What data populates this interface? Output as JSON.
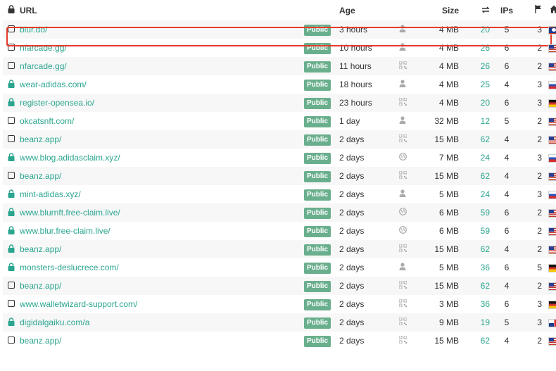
{
  "headers": {
    "url": "URL",
    "age": "Age",
    "size": "Size",
    "ips": "IPs"
  },
  "badge_label": "Public",
  "rows": [
    {
      "url": "blur.do/",
      "age": "3 hours",
      "type": "user",
      "size": "4 MB",
      "links": "20",
      "ips": "5",
      "ctry": "3",
      "flag": "bz",
      "locked": false
    },
    {
      "url": "nfarcade.gg/",
      "age": "10 hours",
      "type": "user",
      "size": "4 MB",
      "links": "26",
      "ips": "6",
      "ctry": "2",
      "flag": "us",
      "locked": false
    },
    {
      "url": "nfarcade.gg/",
      "age": "11 hours",
      "type": "qr",
      "size": "4 MB",
      "links": "26",
      "ips": "6",
      "ctry": "2",
      "flag": "us",
      "locked": false
    },
    {
      "url": "wear-adidas.com/",
      "age": "18 hours",
      "type": "user",
      "size": "4 MB",
      "links": "25",
      "ips": "4",
      "ctry": "3",
      "flag": "ru",
      "locked": true
    },
    {
      "url": "register-opensea.io/",
      "age": "23 hours",
      "type": "qr",
      "size": "4 MB",
      "links": "20",
      "ips": "6",
      "ctry": "3",
      "flag": "de",
      "locked": true
    },
    {
      "url": "okcatsnft.com/",
      "age": "1 day",
      "type": "user",
      "size": "32 MB",
      "links": "12",
      "ips": "5",
      "ctry": "2",
      "flag": "us",
      "locked": false
    },
    {
      "url": "beanz.app/",
      "age": "2 days",
      "type": "qr",
      "size": "15 MB",
      "links": "62",
      "ips": "4",
      "ctry": "2",
      "flag": "us",
      "locked": false
    },
    {
      "url": "www.blog.adidasclaim.xyz/",
      "age": "2 days",
      "type": "globe",
      "size": "7 MB",
      "links": "24",
      "ips": "4",
      "ctry": "3",
      "flag": "ru",
      "locked": true
    },
    {
      "url": "beanz.app/",
      "age": "2 days",
      "type": "qr",
      "size": "15 MB",
      "links": "62",
      "ips": "4",
      "ctry": "2",
      "flag": "us",
      "locked": false
    },
    {
      "url": "mint-adidas.xyz/",
      "age": "2 days",
      "type": "user",
      "size": "5 MB",
      "links": "24",
      "ips": "4",
      "ctry": "3",
      "flag": "ru",
      "locked": true
    },
    {
      "url": "www.blurnft.free-claim.live/",
      "age": "2 days",
      "type": "globe",
      "size": "6 MB",
      "links": "59",
      "ips": "6",
      "ctry": "2",
      "flag": "us",
      "locked": true
    },
    {
      "url": "www.blur.free-claim.live/",
      "age": "2 days",
      "type": "globe",
      "size": "6 MB",
      "links": "59",
      "ips": "6",
      "ctry": "2",
      "flag": "us",
      "locked": true
    },
    {
      "url": "beanz.app/",
      "age": "2 days",
      "type": "qr",
      "size": "15 MB",
      "links": "62",
      "ips": "4",
      "ctry": "2",
      "flag": "us",
      "locked": true
    },
    {
      "url": "monsters-deslucrece.com/",
      "age": "2 days",
      "type": "user",
      "size": "5 MB",
      "links": "36",
      "ips": "6",
      "ctry": "5",
      "flag": "de",
      "locked": true
    },
    {
      "url": "beanz.app/",
      "age": "2 days",
      "type": "qr",
      "size": "15 MB",
      "links": "62",
      "ips": "4",
      "ctry": "2",
      "flag": "us",
      "locked": false
    },
    {
      "url": "www.walletwizard-support.com/",
      "age": "2 days",
      "type": "qr",
      "size": "3 MB",
      "links": "36",
      "ips": "6",
      "ctry": "3",
      "flag": "de",
      "locked": false
    },
    {
      "url": "digidalgaiku.com/a",
      "age": "2 days",
      "type": "qr",
      "size": "9 MB",
      "links": "19",
      "ips": "5",
      "ctry": "3",
      "flag": "pa",
      "locked": true
    },
    {
      "url": "beanz.app/",
      "age": "2 days",
      "type": "qr",
      "size": "15 MB",
      "links": "62",
      "ips": "4",
      "ctry": "2",
      "flag": "us",
      "locked": false
    }
  ],
  "colors": {
    "link": "#2aa58f",
    "badge": "#6aaf8d",
    "highlight": "#e53b2c"
  }
}
